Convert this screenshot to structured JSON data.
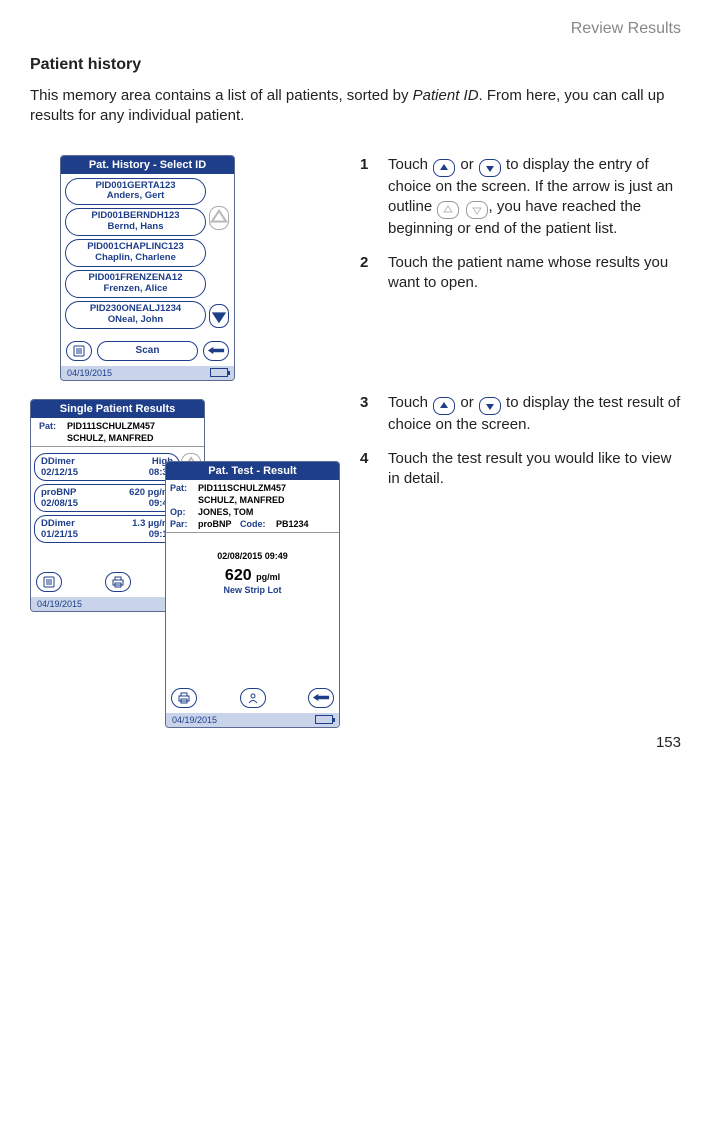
{
  "chapter": "Review Results",
  "section_title": "Patient history",
  "intro_a": "This memory area contains a list of all patients, sorted by ",
  "intro_em": "Patient ID",
  "intro_b": ". From here, you can call up results for any individual patient.",
  "steps": {
    "1": {
      "num": "1",
      "a": "Touch ",
      "b": " or ",
      "c": " to display the entry of choice on the screen. If the arrow is just an outline ",
      "d": ", you have reached the beginning or end of the patient list."
    },
    "2": {
      "num": "2",
      "text": "Touch the patient name whose results you want to open."
    },
    "3": {
      "num": "3",
      "a": "Touch ",
      "b": " or ",
      "c": " to display the test result of choice on the screen."
    },
    "4": {
      "num": "4",
      "text": "Touch the test result you would like to view in detail."
    }
  },
  "device1": {
    "title": "Pat. History - Select ID",
    "patients": [
      {
        "id": "PID001GERTA123",
        "name": "Anders, Gert"
      },
      {
        "id": "PID001BERNDH123",
        "name": "Bernd, Hans"
      },
      {
        "id": "PID001CHAPLINC123",
        "name": "Chaplin, Charlene"
      },
      {
        "id": "PID001FRENZENA12",
        "name": "Frenzen, Alice"
      },
      {
        "id": "PID230ONEALJ1234",
        "name": "ONeal, John"
      }
    ],
    "scan": "Scan",
    "date": "04/19/2015"
  },
  "device2": {
    "title": "Single Patient Results",
    "pat_label": "Pat:",
    "pat_id": "PID111SCHULZM457",
    "pat_name": "SCHULZ, MANFRED",
    "rows": [
      {
        "l1": "DDimer",
        "r1": "High",
        "l2": "02/12/15",
        "r2": "08:30"
      },
      {
        "l1": "proBNP",
        "r1": "620 pg/ml",
        "l2": "02/08/15",
        "r2": "09:49"
      },
      {
        "l1": "DDimer",
        "r1": "1.3 µg/ml",
        "l2": "01/21/15",
        "r2": "09:15"
      }
    ],
    "date": "04/19/2015"
  },
  "device3": {
    "title": "Pat. Test - Result",
    "labels": {
      "pat": "Pat:",
      "op": "Op:",
      "par": "Par:",
      "code": "Code:"
    },
    "pat_id": "PID111SCHULZM457",
    "pat_name": "SCHULZ, MANFRED",
    "op": "JONES, TOM",
    "par": "proBNP",
    "code": "PB1234",
    "timestamp": "02/08/2015  09:49",
    "value": "620",
    "unit": "pg/ml",
    "sub": "New Strip Lot",
    "date": "04/19/2015"
  },
  "page_number": "153"
}
